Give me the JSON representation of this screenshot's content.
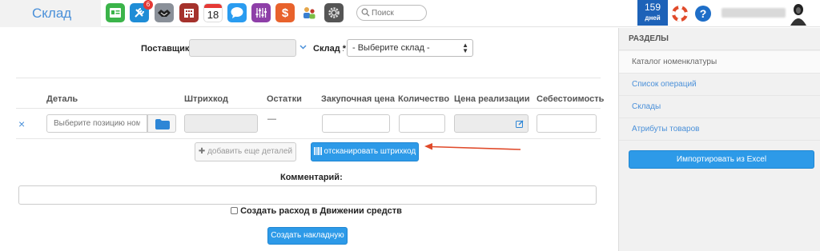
{
  "header": {
    "brand": "Склад",
    "apps": [
      {
        "icon": "contacts-icon",
        "color": "#3bb44a"
      },
      {
        "icon": "tools-icon",
        "color": "#1f8dd6",
        "badge": "6"
      },
      {
        "icon": "handshake-icon",
        "color": "#8a9099"
      },
      {
        "icon": "building-icon",
        "color": "#a5322c"
      },
      {
        "icon": "calendar-icon",
        "color": "#ffffff",
        "text": "18"
      },
      {
        "icon": "chat-icon",
        "color": "#2a9cf0"
      },
      {
        "icon": "sliders-icon",
        "color": "#8e3fa8"
      },
      {
        "icon": "dollar-icon",
        "color": "#e8622c",
        "text": "$"
      },
      {
        "icon": "users-icon",
        "color": "#ffffff"
      },
      {
        "icon": "settings-icon",
        "color": "#555555"
      }
    ],
    "search_placeholder": "Поиск",
    "days_count": "159",
    "days_label": "дней",
    "help_glyph": "?"
  },
  "form": {
    "supplier_label": "Поставщик",
    "warehouse_label": "Склад *",
    "warehouse_value": "- Выберите склад -",
    "columns": [
      "Деталь",
      "Штрихкод",
      "Остатки",
      "Закупочная цена",
      "Количество",
      "Цена реализации",
      "Себестоимость"
    ],
    "row": {
      "remove_glyph": "×",
      "part_placeholder": "Выберите позицию номе",
      "stock_value": "—"
    },
    "add_more_button": "добавить еще деталей",
    "scan_button": "отсканировать штрихкод",
    "comment_label": "Комментарий:",
    "create_expense_label": "Создать расход в Движении средств",
    "create_invoice_button": "Создать накладную"
  },
  "sidebar": {
    "heading": "РАЗДЕЛЫ",
    "items": [
      "Каталог номенклатуры",
      "Список операций",
      "Склады",
      "Атрибуты товаров"
    ],
    "import_button": "Импортировать из Excel"
  },
  "colors": {
    "accent": "#2d9ae8",
    "annotation_arrow": "#e04a2a"
  }
}
